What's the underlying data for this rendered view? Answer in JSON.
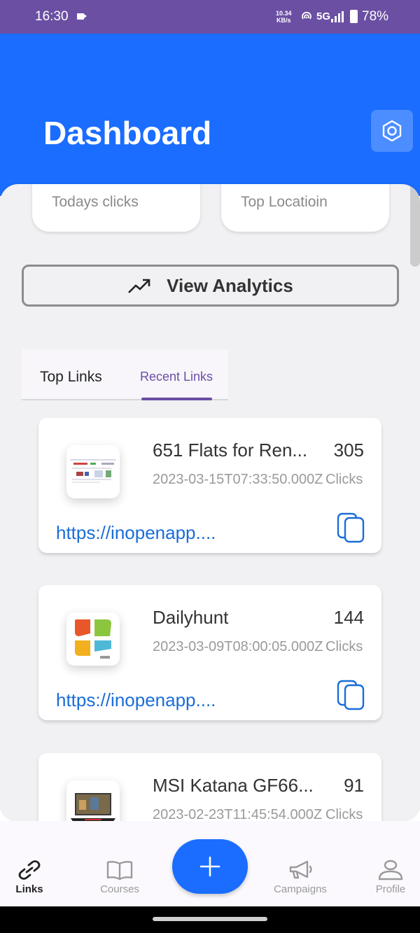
{
  "status_bar": {
    "time": "16:30",
    "speed_value": "10.34",
    "speed_unit": "KB/s",
    "network": "5G",
    "battery": "78%"
  },
  "header": {
    "title": "Dashboard",
    "settings_icon": "hexagon-settings-icon"
  },
  "stats": {
    "todays_clicks_label": "Todays clicks",
    "top_location_label": "Top Locatioin"
  },
  "analytics_button": {
    "label": "View Analytics",
    "icon": "trending-up-icon"
  },
  "tabs": {
    "top_links": "Top Links",
    "recent_links": "Recent Links",
    "active": "Recent Links"
  },
  "links": [
    {
      "title": "651 Flats for Ren...",
      "count": "305",
      "date": "2023-03-15T07:33:50.000Z",
      "clicks_label": "Clicks",
      "url": "https://inopenapp...."
    },
    {
      "title": "Dailyhunt",
      "count": "144",
      "date": "2023-03-09T08:00:05.000Z",
      "clicks_label": "Clicks",
      "url": "https://inopenapp...."
    },
    {
      "title": "MSI Katana GF66...",
      "count": "91",
      "date": "2023-02-23T11:45:54.000Z",
      "clicks_label": "Clicks",
      "url": ""
    }
  ],
  "bottom_nav": {
    "links": "Links",
    "courses": "Courses",
    "campaigns": "Campaigns",
    "profile": "Profile",
    "active": "Links"
  },
  "colors": {
    "status_bar": "#6b4fa3",
    "primary": "#1a6dff",
    "accent": "#6b4fa3",
    "background": "#f1f0f3"
  }
}
